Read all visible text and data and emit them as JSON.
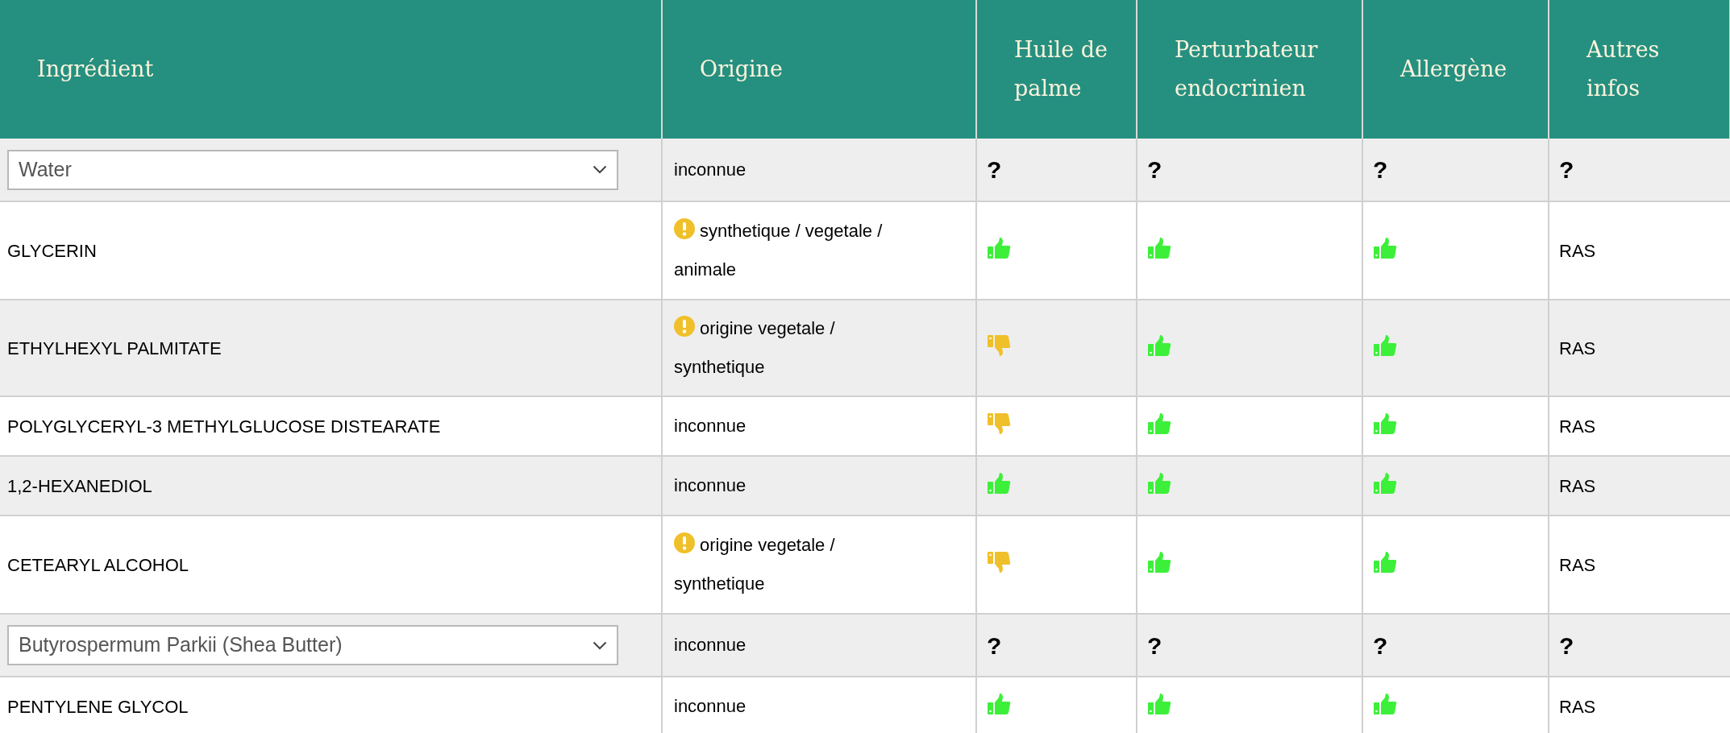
{
  "columns": [
    "Ingrédient",
    "Origine",
    "Huile de palme",
    "Perturbateur endocrinien",
    "Allergène",
    "Autres infos"
  ],
  "rows": [
    {
      "ingredient": {
        "kind": "select",
        "value": "Water"
      },
      "origin": {
        "text": "inconnue",
        "warning": false
      },
      "palm_oil": {
        "kind": "unknown",
        "text": "?"
      },
      "endocrine": {
        "kind": "unknown",
        "text": "?"
      },
      "allergen": {
        "kind": "unknown",
        "text": "?"
      },
      "other_info": {
        "kind": "unknown",
        "text": "?"
      }
    },
    {
      "ingredient": {
        "kind": "text",
        "text": "GLYCERIN"
      },
      "origin": {
        "text": "synthetique / vegetale / animale",
        "warning": true
      },
      "palm_oil": {
        "kind": "good"
      },
      "endocrine": {
        "kind": "good"
      },
      "allergen": {
        "kind": "good"
      },
      "other_info": {
        "kind": "text",
        "text": "RAS"
      }
    },
    {
      "ingredient": {
        "kind": "text",
        "text": "ETHYLHEXYL PALMITATE"
      },
      "origin": {
        "text": "origine vegetale / synthetique",
        "warning": true
      },
      "palm_oil": {
        "kind": "bad"
      },
      "endocrine": {
        "kind": "good"
      },
      "allergen": {
        "kind": "good"
      },
      "other_info": {
        "kind": "text",
        "text": "RAS"
      }
    },
    {
      "ingredient": {
        "kind": "text",
        "text": "POLYGLYCERYL-3 METHYLGLUCOSE DISTEARATE"
      },
      "origin": {
        "text": "inconnue",
        "warning": false
      },
      "palm_oil": {
        "kind": "bad"
      },
      "endocrine": {
        "kind": "good"
      },
      "allergen": {
        "kind": "good"
      },
      "other_info": {
        "kind": "text",
        "text": "RAS"
      }
    },
    {
      "ingredient": {
        "kind": "text",
        "text": "1,2-HEXANEDIOL"
      },
      "origin": {
        "text": "inconnue",
        "warning": false
      },
      "palm_oil": {
        "kind": "good"
      },
      "endocrine": {
        "kind": "good"
      },
      "allergen": {
        "kind": "good"
      },
      "other_info": {
        "kind": "text",
        "text": "RAS"
      }
    },
    {
      "ingredient": {
        "kind": "text",
        "text": "CETEARYL ALCOHOL"
      },
      "origin": {
        "text": "origine vegetale / synthetique",
        "warning": true
      },
      "palm_oil": {
        "kind": "bad"
      },
      "endocrine": {
        "kind": "good"
      },
      "allergen": {
        "kind": "good"
      },
      "other_info": {
        "kind": "text",
        "text": "RAS"
      }
    },
    {
      "ingredient": {
        "kind": "select",
        "value": "Butyrospermum Parkii (Shea Butter)"
      },
      "origin": {
        "text": "inconnue",
        "warning": false
      },
      "palm_oil": {
        "kind": "unknown",
        "text": "?"
      },
      "endocrine": {
        "kind": "unknown",
        "text": "?"
      },
      "allergen": {
        "kind": "unknown",
        "text": "?"
      },
      "other_info": {
        "kind": "unknown",
        "text": "?"
      }
    },
    {
      "ingredient": {
        "kind": "text",
        "text": "PENTYLENE GLYCOL"
      },
      "origin": {
        "text": "inconnue",
        "warning": false
      },
      "palm_oil": {
        "kind": "good"
      },
      "endocrine": {
        "kind": "good"
      },
      "allergen": {
        "kind": "good"
      },
      "other_info": {
        "kind": "text",
        "text": "RAS"
      }
    }
  ]
}
